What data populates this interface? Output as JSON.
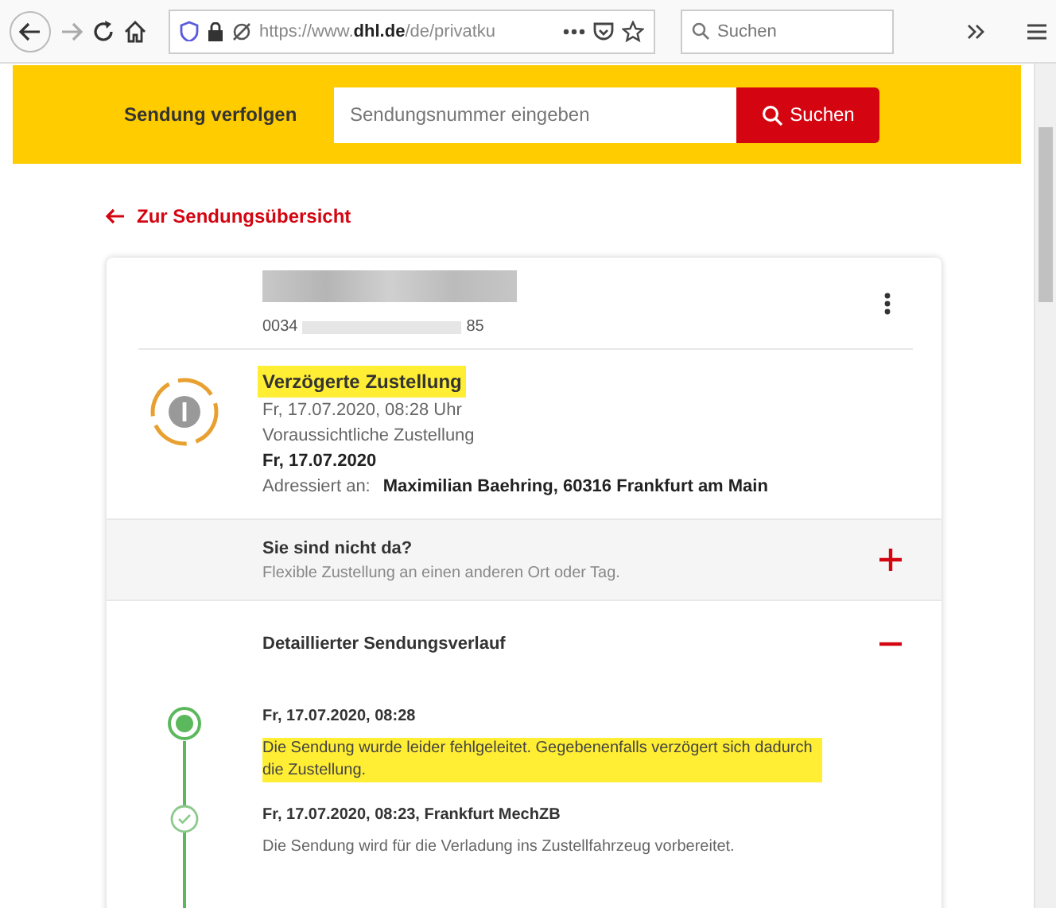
{
  "browser": {
    "url": "https://www.**dhl.de**/de/privatku",
    "search": {
      "placeholder": "Suchen"
    }
  },
  "tracking_bar": {
    "label": "Sendung verfolgen",
    "field": {
      "placeholder": "Sendungsnummer eingeben"
    },
    "button": "Suchen"
  },
  "back_link": "Zur Sendungsübersicht",
  "shipment": {
    "number_start": "0034",
    "number_end": "85",
    "status": "Verzögerte Zustellung",
    "status_highlighted": true,
    "status_time": "Fr, 17.07.2020, 08:28 Uhr",
    "expected_label": "Voraussichtliche Zustellung",
    "expected_date": "Fr, 17.07.2020",
    "address_label": "Adressiert an:",
    "address": "Maximilian Baehring, 60316 Frankfurt am Main"
  },
  "sections": [
    {
      "title": "Sie sind nicht da?",
      "subtitle": "Flexible Zustellung an einen anderen Ort oder Tag.",
      "expanded": false
    },
    {
      "title": "Detaillierter Sendungsverlauf",
      "expanded": true,
      "events": [
        {
          "kind": "current",
          "time": "Fr, 17.07.2020, 08:28",
          "text": "Die Sendung wurde leider fehlgeleitet. Gegebenenfalls verzögert sich dadurch die Zustellung.",
          "highlighted": true
        },
        {
          "kind": "done",
          "time": "Fr, 17.07.2020, 08:23, Frankfurt MechZB",
          "text": "Die Sendung wird für die Verladung ins Zustellfahrzeug vorbereitet.",
          "highlighted": false
        }
      ]
    }
  ]
}
